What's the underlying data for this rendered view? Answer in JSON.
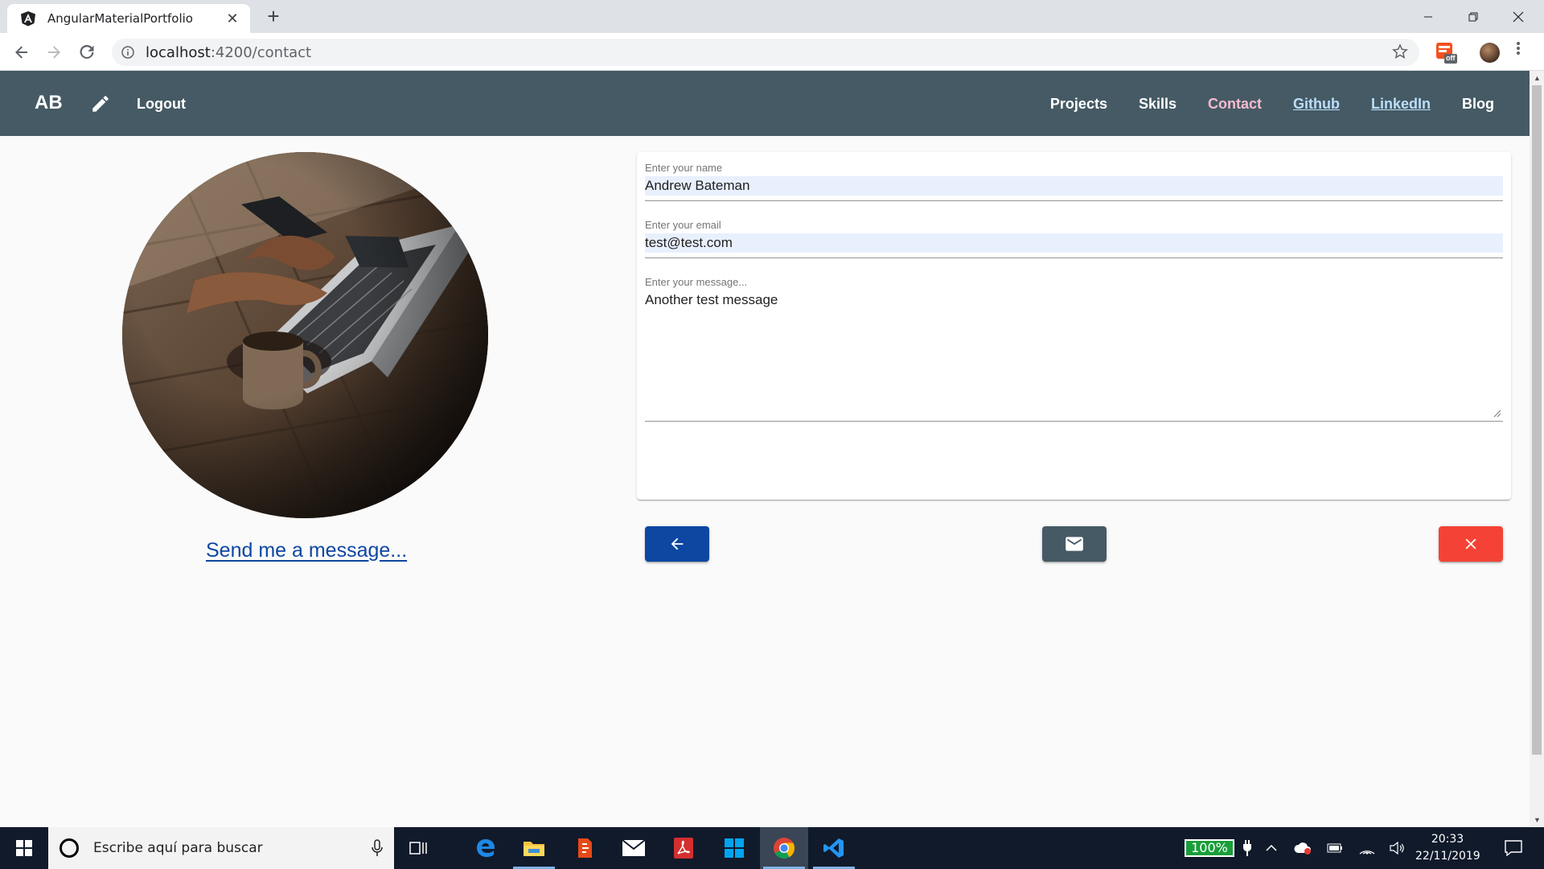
{
  "browser": {
    "tab_title": "AngularMaterialPortfolio",
    "tab_close": "✕",
    "new_tab": "+",
    "url_host": "localhost",
    "url_rest": ":4200/contact",
    "extension_badge": "off"
  },
  "header": {
    "brand": "AB",
    "logout": "Logout",
    "nav": [
      "Projects",
      "Skills",
      "Contact",
      "Github",
      "LinkedIn",
      "Blog"
    ]
  },
  "main": {
    "caption": "Send me a message...",
    "form": {
      "name_label": "Enter your name",
      "name_value": "Andrew Bateman",
      "email_label": "Enter your email",
      "email_value": "test@test.com",
      "message_label": "Enter your message...",
      "message_value": "Another test message"
    },
    "buttons": {
      "back_color": "#0d47a1",
      "send_color": "#455a64",
      "clear_color": "#f44336"
    }
  },
  "taskbar": {
    "search_placeholder": "Escribe aquí para buscar",
    "battery": "100%",
    "time": "20:33",
    "date": "22/11/2019"
  },
  "colors": {
    "header": "#455a64",
    "active_link": "#f8bbd0",
    "external_link": "#bbdefb",
    "caption": "#0d47a1"
  }
}
